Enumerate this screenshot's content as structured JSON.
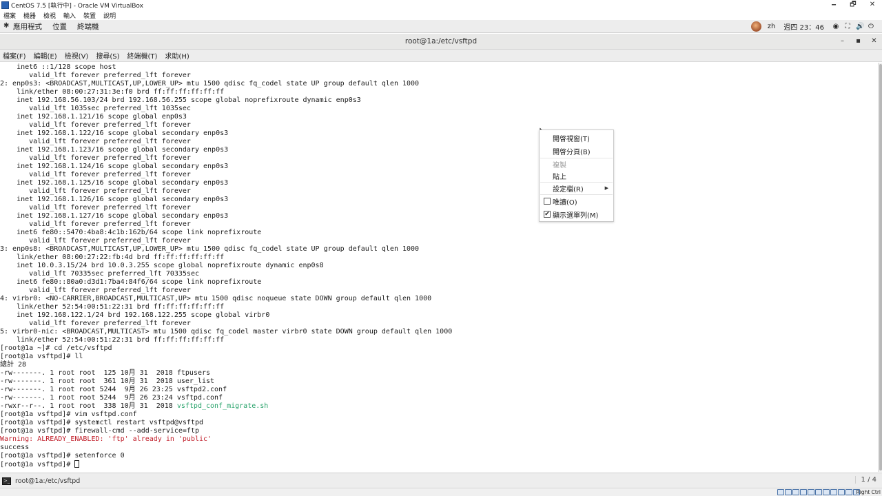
{
  "vbox": {
    "title": "CentOS 7.5 [執行中] - Oracle VM VirtualBox",
    "menu": [
      "檔案",
      "機器",
      "檢視",
      "輸入",
      "裝置",
      "說明"
    ],
    "minimize": "🗕",
    "restore": "🗗",
    "close": "✕"
  },
  "gnome": {
    "menu": [
      "應用程式",
      "位置",
      "終端機"
    ],
    "input_method": "zh",
    "clock": "週四 23：46"
  },
  "terminal": {
    "title": "root@1a:/etc/vsftpd",
    "minimize": "–",
    "maximize": "▪",
    "close": "✕",
    "menu": [
      "檔案(F)",
      "編輯(E)",
      "檢視(V)",
      "搜尋(S)",
      "終端機(T)",
      "求助(H)"
    ],
    "lines": [
      {
        "text": "    inet6 ::1/128 scope host",
        "color": "normal"
      },
      {
        "text": "       valid_lft forever preferred_lft forever",
        "color": "normal"
      },
      {
        "text": "2: enp0s3: <BROADCAST,MULTICAST,UP,LOWER_UP> mtu 1500 qdisc fq_codel state UP group default qlen 1000",
        "color": "normal"
      },
      {
        "text": "    link/ether 08:00:27:31:3e:f0 brd ff:ff:ff:ff:ff:ff",
        "color": "normal"
      },
      {
        "text": "    inet 192.168.56.103/24 brd 192.168.56.255 scope global noprefixroute dynamic enp0s3",
        "color": "normal"
      },
      {
        "text": "       valid_lft 1035sec preferred_lft 1035sec",
        "color": "normal"
      },
      {
        "text": "    inet 192.168.1.121/16 scope global enp0s3",
        "color": "normal"
      },
      {
        "text": "       valid_lft forever preferred_lft forever",
        "color": "normal"
      },
      {
        "text": "    inet 192.168.1.122/16 scope global secondary enp0s3",
        "color": "normal"
      },
      {
        "text": "       valid_lft forever preferred_lft forever",
        "color": "normal"
      },
      {
        "text": "    inet 192.168.1.123/16 scope global secondary enp0s3",
        "color": "normal"
      },
      {
        "text": "       valid_lft forever preferred_lft forever",
        "color": "normal"
      },
      {
        "text": "    inet 192.168.1.124/16 scope global secondary enp0s3",
        "color": "normal"
      },
      {
        "text": "       valid_lft forever preferred_lft forever",
        "color": "normal"
      },
      {
        "text": "    inet 192.168.1.125/16 scope global secondary enp0s3",
        "color": "normal"
      },
      {
        "text": "       valid_lft forever preferred_lft forever",
        "color": "normal"
      },
      {
        "text": "    inet 192.168.1.126/16 scope global secondary enp0s3",
        "color": "normal"
      },
      {
        "text": "       valid_lft forever preferred_lft forever",
        "color": "normal"
      },
      {
        "text": "    inet 192.168.1.127/16 scope global secondary enp0s3",
        "color": "normal"
      },
      {
        "text": "       valid_lft forever preferred_lft forever",
        "color": "normal"
      },
      {
        "text": "    inet6 fe80::5470:4ba8:4c1b:162b/64 scope link noprefixroute",
        "color": "normal"
      },
      {
        "text": "       valid_lft forever preferred_lft forever",
        "color": "normal"
      },
      {
        "text": "3: enp0s8: <BROADCAST,MULTICAST,UP,LOWER_UP> mtu 1500 qdisc fq_codel state UP group default qlen 1000",
        "color": "normal"
      },
      {
        "text": "    link/ether 08:00:27:22:fb:4d brd ff:ff:ff:ff:ff:ff",
        "color": "normal"
      },
      {
        "text": "    inet 10.0.3.15/24 brd 10.0.3.255 scope global noprefixroute dynamic enp0s8",
        "color": "normal"
      },
      {
        "text": "       valid_lft 70335sec preferred_lft 70335sec",
        "color": "normal"
      },
      {
        "text": "    inet6 fe80::80a0:d3d1:7ba4:84f6/64 scope link noprefixroute",
        "color": "normal"
      },
      {
        "text": "       valid_lft forever preferred_lft forever",
        "color": "normal"
      },
      {
        "text": "4: virbr0: <NO-CARRIER,BROADCAST,MULTICAST,UP> mtu 1500 qdisc noqueue state DOWN group default qlen 1000",
        "color": "normal"
      },
      {
        "text": "    link/ether 52:54:00:51:22:31 brd ff:ff:ff:ff:ff:ff",
        "color": "normal"
      },
      {
        "text": "    inet 192.168.122.1/24 brd 192.168.122.255 scope global virbr0",
        "color": "normal"
      },
      {
        "text": "       valid_lft forever preferred_lft forever",
        "color": "normal"
      },
      {
        "text": "5: virbr0-nic: <BROADCAST,MULTICAST> mtu 1500 qdisc fq_codel master virbr0 state DOWN group default qlen 1000",
        "color": "normal"
      },
      {
        "text": "    link/ether 52:54:00:51:22:31 brd ff:ff:ff:ff:ff:ff",
        "color": "normal"
      },
      {
        "text": "[root@1a ~]# cd /etc/vsftpd",
        "color": "normal"
      },
      {
        "text": "[root@1a vsftpd]# ll",
        "color": "normal"
      },
      {
        "text": "總計 28",
        "color": "normal"
      },
      {
        "text": "-rw-------. 1 root root  125 10月 31  2018 ftpusers",
        "color": "normal"
      },
      {
        "text": "-rw-------. 1 root root  361 10月 31  2018 user_list",
        "color": "normal"
      },
      {
        "text": "-rw-------. 1 root root 5244  9月 26 23:25 vsftpd2.conf",
        "color": "normal"
      },
      {
        "text": "-rw-------. 1 root root 5244  9月 26 23:24 vsftpd.conf",
        "color": "normal"
      },
      {
        "text": "-rwxr--r--. 1 root root  338 10月 31  2018 ",
        "color": "normal",
        "suffix": "vsftpd_conf_migrate.sh"
      },
      {
        "text": "[root@1a vsftpd]# vim vsftpd.conf",
        "color": "normal"
      },
      {
        "text": "[root@1a vsftpd]# systemctl restart vsftpd@vsftpd",
        "color": "normal"
      },
      {
        "text": "[root@1a vsftpd]# firewall-cmd --add-service=ftp",
        "color": "normal"
      },
      {
        "text": "Warning: ALREADY_ENABLED: 'ftp' already in 'public'",
        "color": "red"
      },
      {
        "text": "success",
        "color": "normal"
      },
      {
        "text": "[root@1a vsftpd]# setenforce 0",
        "color": "normal"
      },
      {
        "text": "[root@1a vsftpd]# ",
        "color": "normal",
        "cursor": true
      }
    ],
    "colors": {
      "text": "#1a1a1a",
      "error": "#c01c28",
      "executable": "#26a269"
    }
  },
  "context_menu": {
    "items": [
      {
        "label": "開啓視窗(T)",
        "enabled": true
      },
      {
        "label": "開啓分頁(B)",
        "enabled": true
      },
      {
        "label": "複製",
        "enabled": false
      },
      {
        "label": "貼上",
        "enabled": true
      },
      {
        "label": "設定檔(R)",
        "enabled": true,
        "submenu": true
      },
      {
        "label": "唯讀(O)",
        "enabled": true,
        "checkbox": true,
        "checked": false
      },
      {
        "label": "顯示選單列(M)",
        "enabled": true,
        "checkbox": true,
        "checked": true
      }
    ]
  },
  "taskbar": {
    "item": "root@1a:/etc/vsftpd",
    "workspace": "1 / 4"
  },
  "statusbar": {
    "host_key": "Right Ctrl"
  }
}
